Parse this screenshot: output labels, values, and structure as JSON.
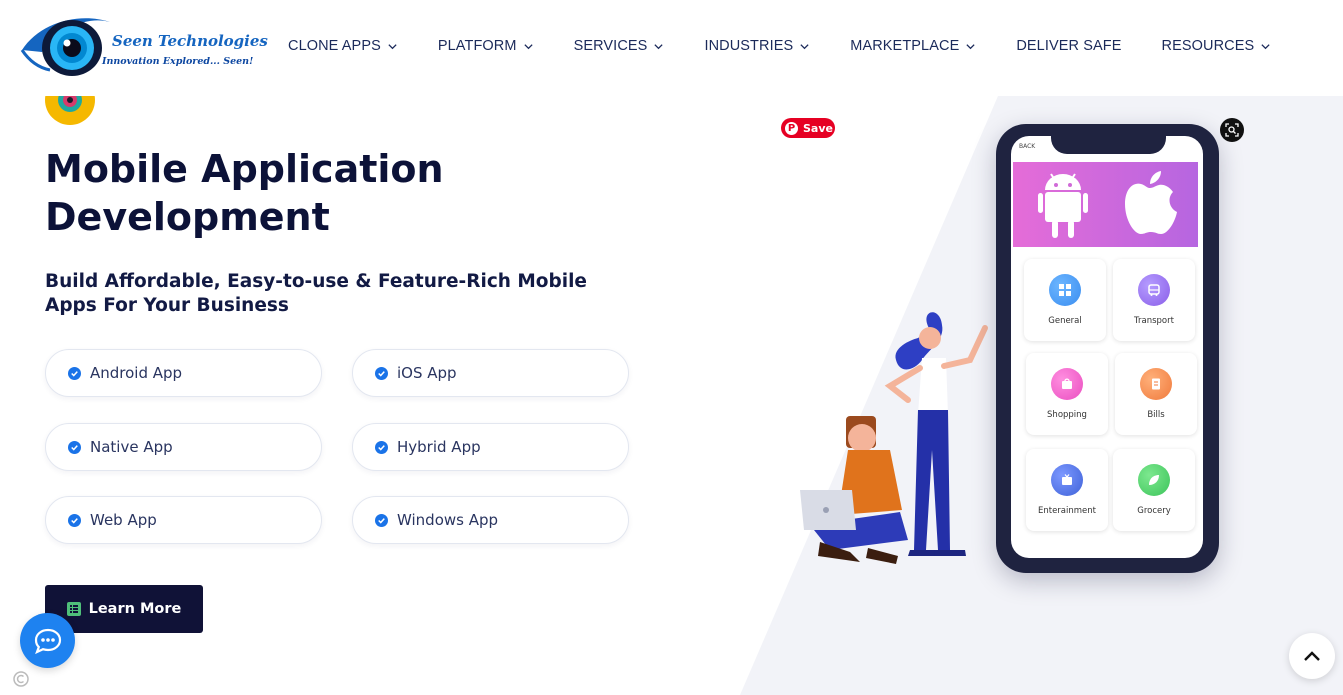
{
  "header": {
    "brand_name": "Seen Technologies",
    "brand_tagline": "Innovation Explored... Seen!",
    "nav": [
      {
        "label": "CLONE APPS",
        "has_dropdown": true
      },
      {
        "label": "PLATFORM",
        "has_dropdown": true
      },
      {
        "label": "SERVICES",
        "has_dropdown": true
      },
      {
        "label": "INDUSTRIES",
        "has_dropdown": true
      },
      {
        "label": "MARKETPLACE",
        "has_dropdown": true
      },
      {
        "label": "DELIVER SAFE",
        "has_dropdown": false
      },
      {
        "label": "RESOURCES",
        "has_dropdown": true
      }
    ]
  },
  "hero": {
    "title": "Mobile Application Development",
    "subtitle": "Build Affordable, Easy-to-use & Feature-Rich Mobile Apps For Your Business",
    "features": [
      "Android App",
      "iOS App",
      "Native App",
      "Hybrid App",
      "Web App",
      "Windows App"
    ],
    "cta_label": "Learn More"
  },
  "illustration": {
    "pinterest_save": "Save",
    "phone_back": "BACK",
    "tiles": [
      {
        "label": "General",
        "color": "#3a8df0",
        "icon": "grid-icon"
      },
      {
        "label": "Transport",
        "color": "#8a5ee8",
        "icon": "bus-icon"
      },
      {
        "label": "Shopping",
        "color": "#ea4ec0",
        "icon": "bag-icon"
      },
      {
        "label": "Bills",
        "color": "#f07a3c",
        "icon": "bill-icon"
      },
      {
        "label": "Enterainment",
        "color": "#3f62d8",
        "icon": "tv-icon"
      },
      {
        "label": "Grocery",
        "color": "#3cc45a",
        "icon": "leaf-icon"
      }
    ]
  },
  "colors": {
    "navy": "#0c1238",
    "button": "#101237",
    "accent_blue": "#1e82f0",
    "check_blue": "#1a73e8"
  }
}
